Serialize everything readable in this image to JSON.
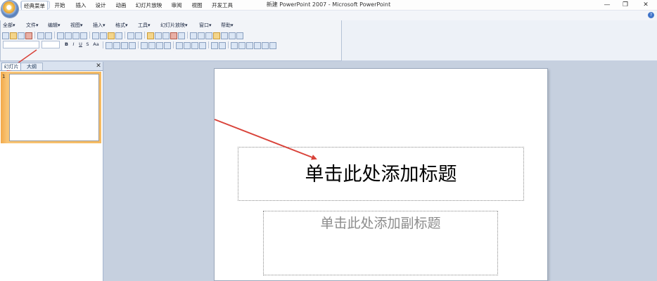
{
  "window": {
    "title": "新建 PowerPoint 2007 - Microsoft PowerPoint",
    "minimize_glyph": "—",
    "restore_glyph": "❐",
    "close_glyph": "✕"
  },
  "quick_access": {
    "save_icon": "save-icon",
    "undo_glyph": "↶",
    "redo_glyph": "↷",
    "more_glyph": "▾"
  },
  "tabs": [
    "经典菜单",
    "开始",
    "插入",
    "设计",
    "动画",
    "幻灯片放映",
    "审阅",
    "视图",
    "开发工具"
  ],
  "menus": [
    "全部▾",
    "文件▾",
    "编辑▾",
    "视图▾",
    "插入▾",
    "格式▾",
    "工具▾",
    "幻灯片放映▾",
    "窗口▾",
    "帮助▾"
  ],
  "format_buttons": [
    "B",
    "I",
    "U",
    "S",
    "Aa"
  ],
  "pane": {
    "slides_tab": "幻灯片",
    "outline_tab": "大纲",
    "close_glyph": "✕",
    "slide_number": "1"
  },
  "slide": {
    "title_placeholder": "单击此处添加标题",
    "subtitle_placeholder": "单击此处添加副标题"
  },
  "colors": {
    "annotation_arrow": "#d9433a",
    "thumb_highlight": "#f5b050",
    "ribbon_bg": "#f2f4f8",
    "workspace_bg": "#c6d0df"
  }
}
